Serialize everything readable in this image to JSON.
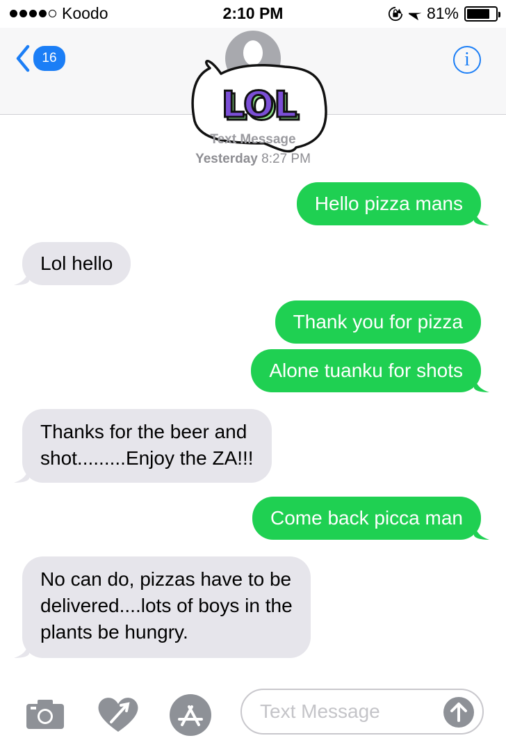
{
  "status_bar": {
    "carrier": "Koodo",
    "time": "2:10 PM",
    "battery": "81%",
    "battery_level": 0.81
  },
  "header": {
    "back_count": "16",
    "info_label": "i"
  },
  "sticker": {
    "text": "LOL"
  },
  "conversation_meta": {
    "service": "Text Message",
    "day": "Yesterday",
    "time": "8:27 PM"
  },
  "messages": [
    {
      "from": "me",
      "text": "Hello pizza mans"
    },
    {
      "from": "them",
      "text": "Lol hello"
    },
    {
      "from": "me",
      "text": "Thank you for pizza"
    },
    {
      "from": "me",
      "text": "Alone tuanku for shots"
    },
    {
      "from": "them",
      "lines": [
        "Thanks for the beer and",
        "shot.........Enjoy the ZA!!!"
      ]
    },
    {
      "from": "me",
      "text": "Come back picca man"
    },
    {
      "from": "them",
      "lines": [
        "No can do, pizzas have to be",
        "delivered....lots of boys in the",
        "plants be hungry."
      ]
    }
  ],
  "composer": {
    "placeholder": "Text Message"
  },
  "icons": {
    "back": "chevron-left-icon",
    "info": "info-icon",
    "camera": "camera-icon",
    "digital_touch": "heart-icon",
    "app_store": "app-store-icon",
    "send": "arrow-up-icon"
  },
  "colors": {
    "sent_bubble": "#1fd052",
    "received_bubble": "#e6e5eb",
    "accent": "#1b7ef6",
    "sticker_purple": "#7b4fd6",
    "sticker_green": "#8fe88a"
  }
}
